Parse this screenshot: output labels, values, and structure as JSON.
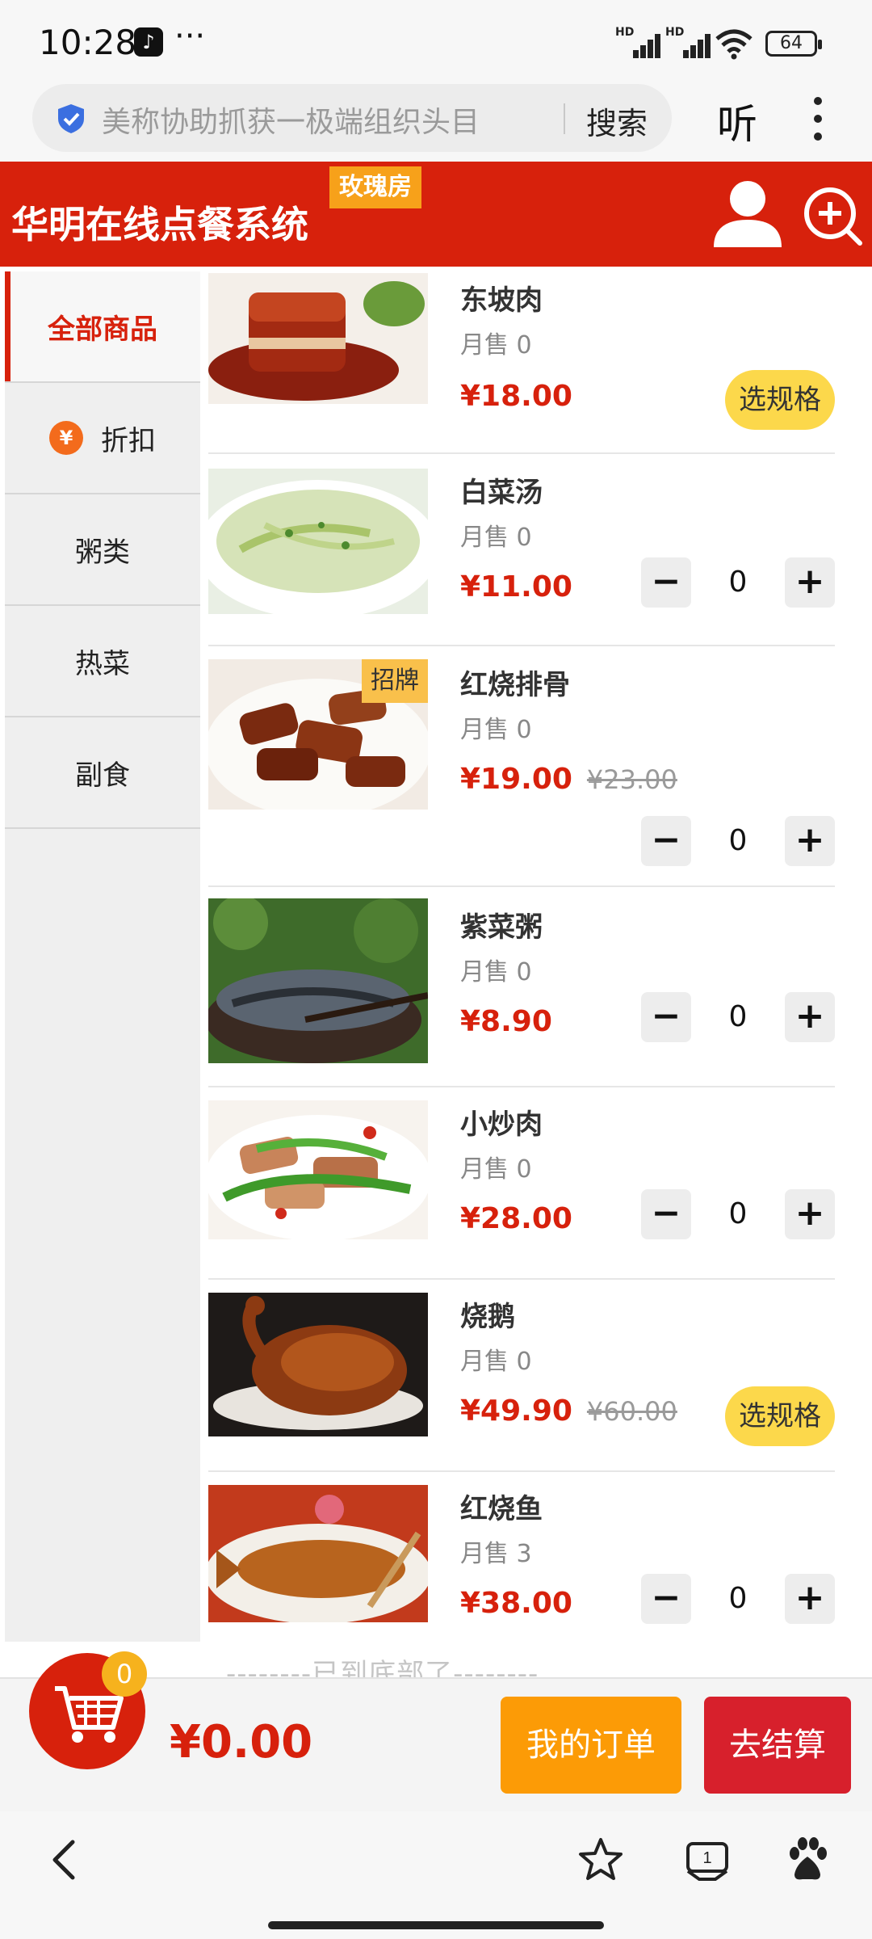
{
  "status_bar": {
    "time": "10:28",
    "more": "···",
    "signal_label": "HD",
    "battery": "64"
  },
  "browser": {
    "url_text": "美称协助抓获一极端组织头目",
    "search_label": "搜索",
    "listen_label": "听"
  },
  "header": {
    "title": "华明在线点餐系统",
    "room_badge": "玫瑰房"
  },
  "sidebar": {
    "categories": [
      {
        "label": "全部商品"
      },
      {
        "label": "折扣",
        "icon": "¥"
      },
      {
        "label": "粥类"
      },
      {
        "label": "热菜"
      },
      {
        "label": "副食"
      }
    ]
  },
  "products": [
    {
      "name": "东坡肉",
      "sold": "月售 0",
      "price": "¥18.00",
      "action": "选规格"
    },
    {
      "name": "白菜汤",
      "sold": "月售 0",
      "price": "¥11.00",
      "qty": "0"
    },
    {
      "name": "红烧排骨",
      "sold": "月售 0",
      "price": "¥19.00",
      "original_price": "¥23.00",
      "badge": "招牌",
      "qty": "0"
    },
    {
      "name": "紫菜粥",
      "sold": "月售 0",
      "price": "¥8.90",
      "qty": "0"
    },
    {
      "name": "小炒肉",
      "sold": "月售 0",
      "price": "¥28.00",
      "qty": "0"
    },
    {
      "name": "烧鹅",
      "sold": "月售 0",
      "price": "¥49.90",
      "original_price": "¥60.00",
      "action": "选规格"
    },
    {
      "name": "红烧鱼",
      "sold": "月售 3",
      "price": "¥38.00",
      "qty": "0"
    }
  ],
  "stepper": {
    "minus": "−",
    "plus": "+"
  },
  "list_end": "--------已到底部了--------",
  "cart": {
    "count": "0",
    "total": "¥0.00",
    "orders_label": "我的订单",
    "checkout_label": "去结算"
  },
  "colors": {
    "brand_red": "#d7210c",
    "badge_orange": "#f7a11a",
    "spec_yellow": "#fcd84b",
    "orders_orange": "#fc9b06"
  }
}
